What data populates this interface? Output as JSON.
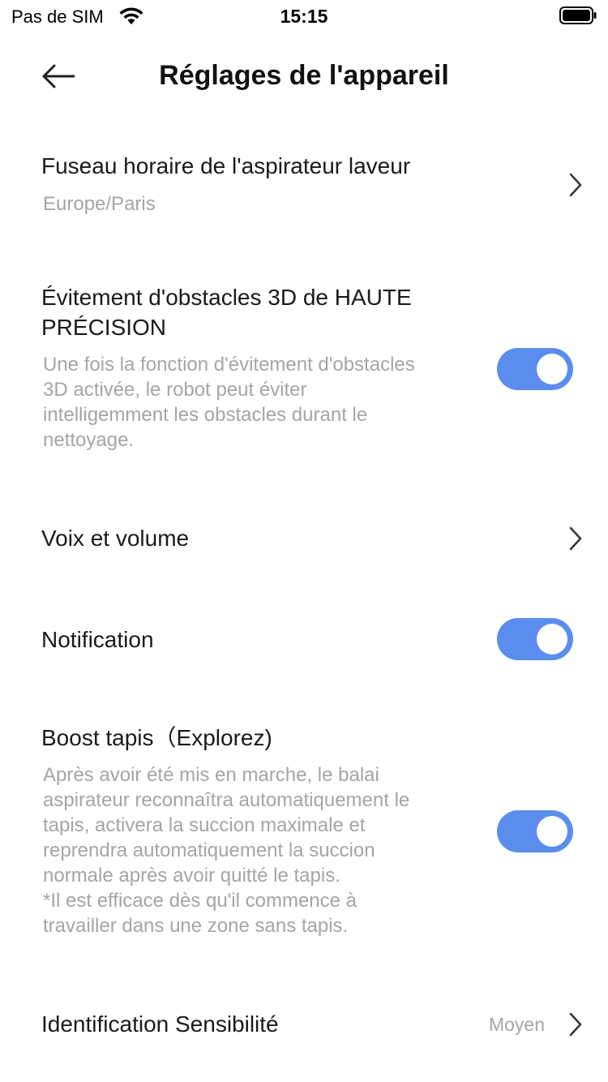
{
  "status_bar": {
    "carrier": "Pas de SIM",
    "time": "15:15",
    "wifi_icon": "wifi-icon",
    "battery_icon": "battery-full-icon"
  },
  "header": {
    "title": "Réglages de l'appareil",
    "back_icon": "arrow-left-icon"
  },
  "settings": {
    "timezone": {
      "title": "Fuseau horaire de l'aspirateur laveur",
      "value": "Europe/Paris"
    },
    "obstacle": {
      "title_line1": "Évitement d'obstacles 3D de HAUTE",
      "title_line2": "PRÉCISION",
      "desc_lines": [
        "Une fois la fonction d'évitement d'obstacles",
        "3D activée, le robot peut éviter",
        "intelligemment les obstacles durant le",
        "nettoyage."
      ],
      "enabled": true
    },
    "voice": {
      "title": "Voix et volume"
    },
    "notification": {
      "title": "Notification",
      "enabled": true
    },
    "carpet": {
      "title": "Boost tapis（Explorez)",
      "desc_lines": [
        "Après avoir été mis en marche, le balai",
        "aspirateur reconnaîtra automatiquement le",
        "tapis, activera la succion maximale et",
        "reprendra automatiquement la succion",
        "normale après avoir quitté le tapis.",
        "*Il est efficace dès qu'il commence à",
        "travailler dans une zone sans tapis."
      ],
      "enabled": true
    },
    "sensitivity": {
      "title": "Identification Sensibilité",
      "value": "Moyen"
    }
  },
  "colors": {
    "toggle_on": "#5b8def",
    "secondary_text": "#a5a5a5",
    "primary_text": "#1a1a1a"
  }
}
